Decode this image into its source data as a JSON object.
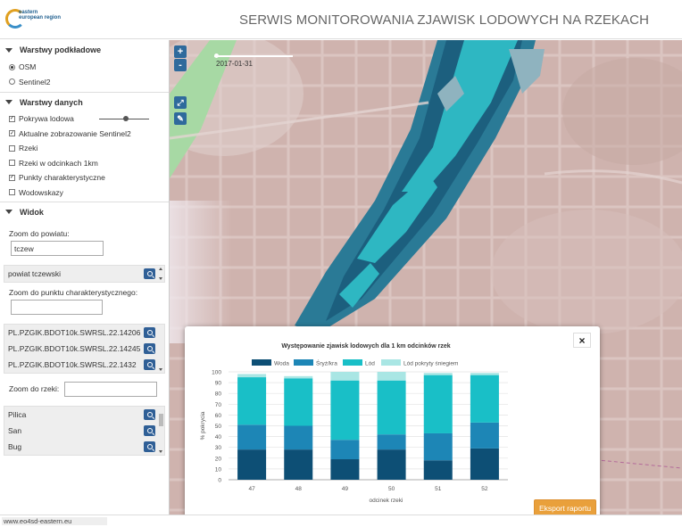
{
  "header": {
    "logo_text": "eastern european region",
    "title": "SERWIS MONITOROWANIA ZJAWISK LODOWYCH NA RZEKACH"
  },
  "sidebar": {
    "base_layers": {
      "heading": "Warstwy podkładowe",
      "options": [
        {
          "label": "OSM",
          "selected": true
        },
        {
          "label": "Sentinel2",
          "selected": false
        }
      ]
    },
    "data_layers": {
      "heading": "Warstwy danych",
      "items": [
        {
          "label": "Pokrywa lodowa",
          "checked": true
        },
        {
          "label": "Aktualne zobrazowanie Sentinel2",
          "checked": true
        },
        {
          "label": "Rzeki",
          "checked": false
        },
        {
          "label": "Rzeki w odcinkach 1km",
          "checked": false
        },
        {
          "label": "Punkty charakterystyczne",
          "checked": true
        },
        {
          "label": "Wodowskazy",
          "checked": false
        }
      ]
    },
    "view": {
      "heading": "Widok",
      "county_zoom_label": "Zoom do powiatu:",
      "county_input_value": "tczew",
      "county_results": [
        "powiat tczewski"
      ],
      "point_zoom_label": "Zoom do punktu charakterystycznego:",
      "point_input_value": "",
      "point_results": [
        "PL.PZGIK.BDOT10k.SWRSL.22.14206",
        "PL.PZGIK.BDOT10k.SWRSL.22.14245",
        "PL.PZGIK.BDOT10k.SWRSL.22.1432"
      ],
      "river_zoom_label": "Zoom do rzeki:",
      "river_input_value": "",
      "river_results": [
        "Pilica",
        "San",
        "Bug"
      ]
    }
  },
  "map": {
    "zoom_in": "+",
    "zoom_out": "-",
    "time_label": "2017-01-31"
  },
  "chart_modal": {
    "close_label": "×",
    "export_label": "Eksport raportu"
  },
  "chart_data": {
    "type": "bar",
    "stacked": true,
    "title": "Występowanie zjawisk lodowych dla 1 km odcinków rzek",
    "xlabel": "odcinek rzeki",
    "ylabel": "% pokrycia",
    "ylim": [
      0,
      100
    ],
    "yticks": [
      0,
      10,
      20,
      30,
      40,
      50,
      60,
      70,
      80,
      90,
      100
    ],
    "categories": [
      "47",
      "48",
      "49",
      "50",
      "51",
      "52"
    ],
    "series": [
      {
        "name": "Woda",
        "color": "#0d4f75",
        "values": [
          28,
          28,
          19,
          28,
          18,
          29
        ]
      },
      {
        "name": "Śryż/kra",
        "color": "#1d86b6",
        "values": [
          23,
          22,
          18,
          14,
          25,
          24
        ]
      },
      {
        "name": "Lód",
        "color": "#19bfc7",
        "values": [
          44,
          44,
          55,
          50,
          54,
          44
        ]
      },
      {
        "name": "Lód pokryty śniegiem",
        "color": "#a9e6e4",
        "values": [
          3,
          2,
          8,
          8,
          2,
          2
        ]
      }
    ],
    "grid": true,
    "legend": "top"
  },
  "footer": {
    "url": "www.eo4sd-eastern.eu"
  }
}
